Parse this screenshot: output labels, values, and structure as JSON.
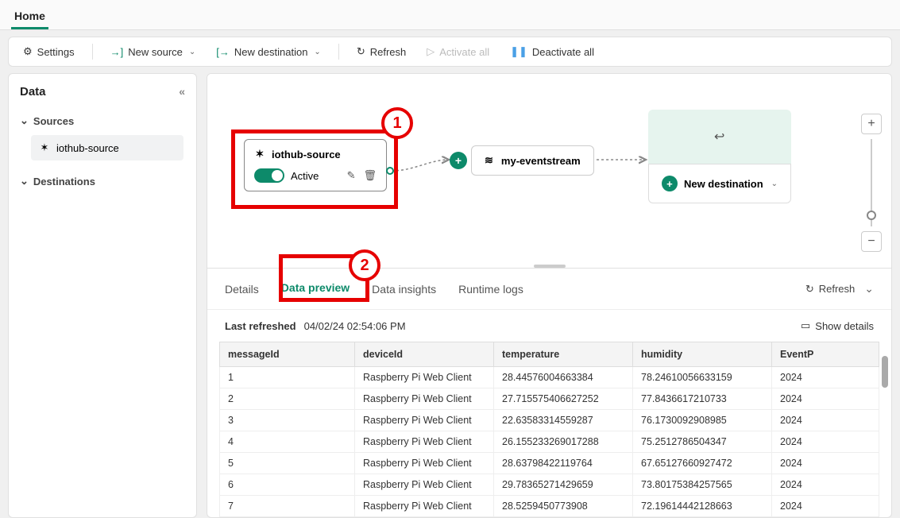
{
  "tab": "Home",
  "toolbar": {
    "settings": "Settings",
    "newSource": "New source",
    "newDest": "New destination",
    "refresh": "Refresh",
    "activateAll": "Activate all",
    "deactivateAll": "Deactivate all"
  },
  "sidebar": {
    "title": "Data",
    "sections": {
      "sources": "Sources",
      "destinations": "Destinations"
    },
    "sourceItem": "iothub-source"
  },
  "canvas": {
    "sourceNode": {
      "title": "iothub-source",
      "status": "Active"
    },
    "streamNode": "my-eventstream",
    "destNode": "New destination",
    "callout1": "1",
    "callout2": "2"
  },
  "panel": {
    "tabs": {
      "details": "Details",
      "preview": "Data preview",
      "insights": "Data insights",
      "logs": "Runtime logs"
    },
    "refresh": "Refresh",
    "lastRefreshedLabel": "Last refreshed",
    "lastRefreshedValue": "04/02/24 02:54:06 PM",
    "showDetails": "Show details",
    "columns": {
      "c1": "messageId",
      "c2": "deviceId",
      "c3": "temperature",
      "c4": "humidity",
      "c5": "EventP"
    },
    "rows": [
      {
        "id": "1",
        "dev": "Raspberry Pi Web Client",
        "t": "28.44576004663384",
        "h": "78.24610056633159",
        "e": "2024"
      },
      {
        "id": "2",
        "dev": "Raspberry Pi Web Client",
        "t": "27.715575406627252",
        "h": "77.8436617210733",
        "e": "2024"
      },
      {
        "id": "3",
        "dev": "Raspberry Pi Web Client",
        "t": "22.63583314559287",
        "h": "76.1730092908985",
        "e": "2024"
      },
      {
        "id": "4",
        "dev": "Raspberry Pi Web Client",
        "t": "26.155233269017288",
        "h": "75.2512786504347",
        "e": "2024"
      },
      {
        "id": "5",
        "dev": "Raspberry Pi Web Client",
        "t": "28.63798422119764",
        "h": "67.65127660927472",
        "e": "2024"
      },
      {
        "id": "6",
        "dev": "Raspberry Pi Web Client",
        "t": "29.78365271429659",
        "h": "73.80175384257565",
        "e": "2024"
      },
      {
        "id": "7",
        "dev": "Raspberry Pi Web Client",
        "t": "28.5259450773908",
        "h": "72.19614442128663",
        "e": "2024"
      }
    ]
  }
}
